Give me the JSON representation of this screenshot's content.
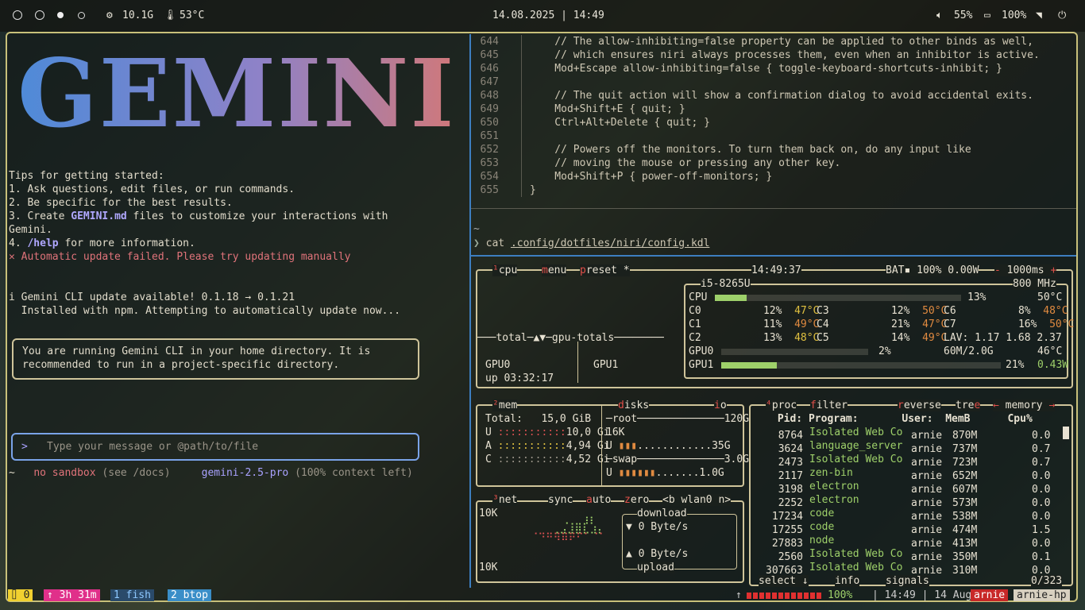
{
  "topbar": {
    "workspaces": [
      "1",
      "2",
      "3",
      "4"
    ],
    "active_workspace": 3,
    "cpu_freq": "10.1G",
    "temp": "53°C",
    "datetime": "14.08.2025 | 14:49",
    "volume": "55%",
    "battery": "100%"
  },
  "gemini": {
    "logo_text": "GEMINI",
    "tips_title": "Tips for getting started:",
    "tip1": "1. Ask questions, edit files, or run commands.",
    "tip2": "2. Be specific for the best results.",
    "tip3_pre": "3. Create ",
    "tip3_bold": "GEMINI.md",
    "tip3_post": " files to customize your interactions with",
    "tip3_cont": "Gemini.",
    "tip4_pre": "4. ",
    "tip4_bold": "/help",
    "tip4_post": " for more information.",
    "update_failed": "✕ Automatic update failed. Please try updating manually",
    "update_avail": "i Gemini CLI update available! 0.1.18 → 0.1.21",
    "installed": "  Installed with npm. Attempting to automatically update now...",
    "warn_line1": "You are running Gemini CLI in your home directory. It is",
    "warn_line2": "recommended to run in a project-specific directory.",
    "input_prompt": ">",
    "input_placeholder": "Type your message or @path/to/file",
    "footer_tilde": "~",
    "sandbox": "no sandbox",
    "sandbox_hint": "(see /docs)",
    "model": "gemini-2.5-pro",
    "context": "(100% context left)"
  },
  "code": {
    "lines": [
      {
        "n": "644",
        "t": "    // The allow-inhibiting=false property can be applied to other binds as well,"
      },
      {
        "n": "645",
        "t": "    // which ensures niri always processes them, even when an inhibitor is active."
      },
      {
        "n": "646",
        "t": "    Mod+Escape allow-inhibiting=false { toggle-keyboard-shortcuts-inhibit; }"
      },
      {
        "n": "647",
        "t": ""
      },
      {
        "n": "648",
        "t": "    // The quit action will show a confirmation dialog to avoid accidental exits."
      },
      {
        "n": "649",
        "t": "    Mod+Shift+E { quit; }"
      },
      {
        "n": "650",
        "t": "    Ctrl+Alt+Delete { quit; }"
      },
      {
        "n": "651",
        "t": ""
      },
      {
        "n": "652",
        "t": "    // Powers off the monitors. To turn them back on, do any input like"
      },
      {
        "n": "653",
        "t": "    // moving the mouse or pressing any other key."
      },
      {
        "n": "654",
        "t": "    Mod+Shift+P { power-off-monitors; }"
      },
      {
        "n": "655",
        "t": "}"
      }
    ],
    "shell_tilde": "~",
    "prompt": "❯",
    "command": "cat",
    "path": ".config/dotfiles/niri/config.kdl"
  },
  "btop": {
    "cpu": {
      "title": "cpu",
      "menu": "menu",
      "preset": "preset *",
      "time": "14:49:37",
      "bat": "BAT▪ 100% 0.00W",
      "interval": "1000ms",
      "model": "i5-8265U",
      "freq": "800 MHz",
      "total_label": "CPU",
      "total_pct": "13%",
      "total_temp": "50°C",
      "cores": [
        {
          "n": "C0",
          "p": "12%",
          "t": "47°C"
        },
        {
          "n": "C3",
          "p": "12%",
          "t": "50°C"
        },
        {
          "n": "C6",
          "p": "8%",
          "t": "48°C"
        },
        {
          "n": "C1",
          "p": "11%",
          "t": "49°C"
        },
        {
          "n": "C4",
          "p": "21%",
          "t": "47°C"
        },
        {
          "n": "C7",
          "p": "16%",
          "t": "50°C"
        },
        {
          "n": "C2",
          "p": "13%",
          "t": "48°C"
        },
        {
          "n": "C5",
          "p": "14%",
          "t": "49°C"
        }
      ],
      "lav": "LAV: 1.17 1.68 2.37",
      "gpu0_label": "GPU0",
      "gpu0_pct": "2%",
      "gpu0_mem": "60M/2.0G",
      "gpu0_temp": "46°C",
      "gpu1_label": "GPU1",
      "gpu1_pct": "21%",
      "gpu1_pow": "0.43W",
      "graph_label": "total─▲▼─gpu-totals",
      "gpu0_name": "GPU0",
      "uptime": "up 03:32:17",
      "gpu1_name": "GPU1"
    },
    "mem": {
      "title": "mem",
      "total_label": "Total:",
      "total": "15,0 GiB",
      "rows": [
        {
          "l": "U",
          "v": "10,0 Gi"
        },
        {
          "l": "A",
          "v": "4,94 Gi"
        },
        {
          "l": "C",
          "v": "4,52 Gi"
        }
      ]
    },
    "disks": {
      "title": "disks",
      "io": "io",
      "root": "root",
      "root_size": "120G",
      "root_io": "16K",
      "root_used": "35G",
      "swap": "swap",
      "swap_size": "3.0G",
      "swap_used": "1.0G"
    },
    "net": {
      "title": "net",
      "sync": "sync",
      "auto": "auto",
      "zero": "zero",
      "iface": "<b wlan0 n>",
      "top": "10K",
      "bottom": "10K",
      "download": "download",
      "dl_rate": "▼ 0 Byte/s",
      "ul_rate": "▲ 0 Byte/s",
      "upload": "upload"
    },
    "proc": {
      "title": "proc",
      "filter": "filter",
      "reverse": "reverse",
      "tree": "tree",
      "sort": "memory",
      "headers": {
        "pid": "Pid:",
        "program": "Program:",
        "user": "User:",
        "mem": "MemB",
        "cpu": "Cpu%"
      },
      "rows": [
        {
          "pid": "8764",
          "prog": "Isolated Web Co",
          "user": "arnie",
          "mem": "870M",
          "cpu": "0.0"
        },
        {
          "pid": "3624",
          "prog": "language_server",
          "user": "arnie",
          "mem": "737M",
          "cpu": "0.7"
        },
        {
          "pid": "2473",
          "prog": "Isolated Web Co",
          "user": "arnie",
          "mem": "723M",
          "cpu": "0.7"
        },
        {
          "pid": "2117",
          "prog": "zen-bin",
          "user": "arnie",
          "mem": "652M",
          "cpu": "0.0"
        },
        {
          "pid": "3198",
          "prog": "electron",
          "user": "arnie",
          "mem": "607M",
          "cpu": "0.0"
        },
        {
          "pid": "2252",
          "prog": "electron",
          "user": "arnie",
          "mem": "573M",
          "cpu": "0.0"
        },
        {
          "pid": "17234",
          "prog": "code",
          "user": "arnie",
          "mem": "538M",
          "cpu": "0.0"
        },
        {
          "pid": "17255",
          "prog": "code",
          "user": "arnie",
          "mem": "474M",
          "cpu": "1.5"
        },
        {
          "pid": "27883",
          "prog": "node",
          "user": "arnie",
          "mem": "413M",
          "cpu": "0.0"
        },
        {
          "pid": "2560",
          "prog": "Isolated Web Co",
          "user": "arnie",
          "mem": "350M",
          "cpu": "0.1"
        },
        {
          "pid": "307663",
          "prog": "Isolated Web Co",
          "user": "arnie",
          "mem": "310M",
          "cpu": "0.0"
        }
      ],
      "select": "select ↓",
      "info": "info",
      "signals": "signals",
      "count": "0/323"
    }
  },
  "statusbar": {
    "left1": "⌷ 0",
    "uptime": "↑ 3h 31m",
    "tab1": "1 fish",
    "tab2": "2 btop",
    "battery_pct": "100%",
    "time": "14:49",
    "date": "14 Aug",
    "user": "arnie",
    "host": "arnie-hp"
  }
}
